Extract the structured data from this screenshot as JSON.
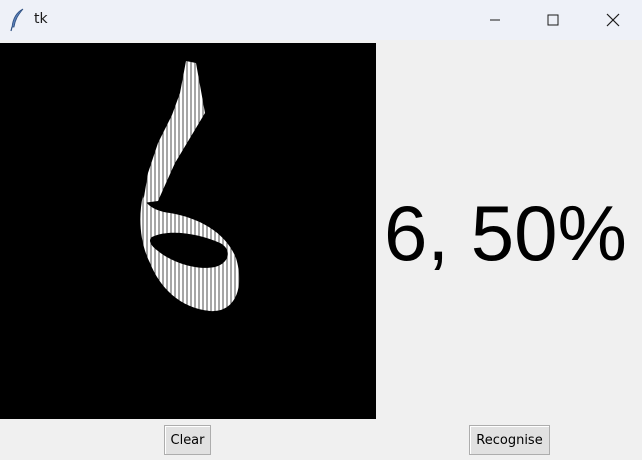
{
  "window": {
    "title": "tk",
    "icon": "feather-icon",
    "controls": [
      "minimize-icon",
      "maximize-icon",
      "close-icon"
    ]
  },
  "canvas": {
    "background": "#000000",
    "stroke_color": "#ffffff",
    "drawn_digit": "6"
  },
  "result": {
    "text": "6, 50%"
  },
  "buttons": {
    "clear_label": "Clear",
    "recognise_label": "Recognise"
  }
}
